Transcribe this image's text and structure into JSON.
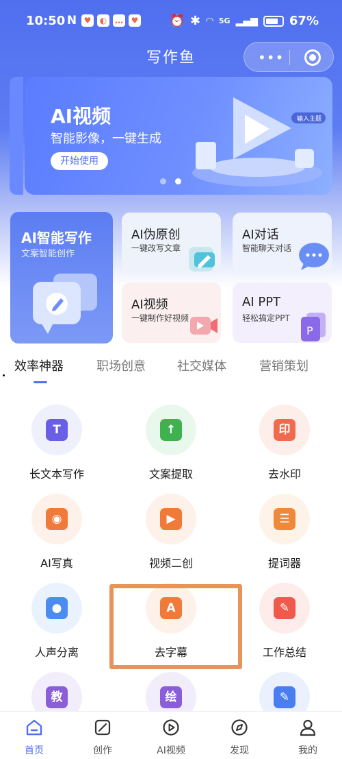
{
  "status_bar": {
    "time": "10:50",
    "battery": "67%",
    "network": "5G"
  },
  "nav": {
    "title": "写作鱼",
    "more_icon": "more-dots-icon",
    "close_icon": "target-icon"
  },
  "banner": {
    "title": "AI视频",
    "subtitle": "智能影像，一键生成",
    "button": "开始使用",
    "illustration_tag": "输入主题",
    "carousel_index": 2,
    "carousel_count": 2
  },
  "features": {
    "main": {
      "title": "AI智能写作",
      "subtitle": "文案智能创作"
    },
    "items": [
      {
        "title": "AI伪原创",
        "subtitle": "一键改写文章"
      },
      {
        "title": "AI对话",
        "subtitle": "智能聊天对话"
      },
      {
        "title": "AI视频",
        "subtitle": "一键制作好视频"
      },
      {
        "title": "AI PPT",
        "subtitle": "轻松搞定PPT"
      }
    ]
  },
  "tabs": [
    {
      "label": "效率神器",
      "active": true
    },
    {
      "label": "职场创意",
      "active": false
    },
    {
      "label": "社交媒体",
      "active": false
    },
    {
      "label": "营销策划",
      "active": false
    }
  ],
  "tools": [
    {
      "label": "长文本写作",
      "icon": "long-text-icon",
      "glyph": "T",
      "color": "#6a5ee6",
      "bg": "#eef0fb"
    },
    {
      "label": "文案提取",
      "icon": "folder-upload-icon",
      "glyph": "↑",
      "color": "#3fb14f",
      "bg": "#e9f8ec"
    },
    {
      "label": "去水印",
      "icon": "stamp-icon",
      "glyph": "印",
      "color": "#f06b4d",
      "bg": "#fdeeea"
    },
    {
      "label": "AI写真",
      "icon": "camera-icon",
      "glyph": "◉",
      "color": "#f07a3a",
      "bg": "#fdf1e9"
    },
    {
      "label": "视频二创",
      "icon": "play-icon",
      "glyph": "▶",
      "color": "#f07a3a",
      "bg": "#fdf1e9"
    },
    {
      "label": "提词器",
      "icon": "teleprompter-icon",
      "glyph": "☰",
      "color": "#f0883a",
      "bg": "#fdf3e9"
    },
    {
      "label": "人声分离",
      "icon": "voice-icon",
      "glyph": "●",
      "color": "#4a8cf0",
      "bg": "#eaf2fd"
    },
    {
      "label": "去字幕",
      "icon": "subtitle-remove-icon",
      "glyph": "A",
      "color": "#f07a3a",
      "bg": "#fdf1e9"
    },
    {
      "label": "工作总结",
      "icon": "edit-doc-icon",
      "glyph": "✎",
      "color": "#ef5a4d",
      "bg": "#fdecea"
    },
    {
      "label": "",
      "icon": "teach-icon",
      "glyph": "教",
      "color": "#8a5ed9",
      "bg": "#f2edfb"
    },
    {
      "label": "",
      "icon": "paint-icon",
      "glyph": "绘",
      "color": "#8a5ed9",
      "bg": "#f2edfb"
    },
    {
      "label": "",
      "icon": "doc-edit-icon",
      "glyph": "✎",
      "color": "#4a7ef0",
      "bg": "#eaf0fd"
    }
  ],
  "bottom_nav": [
    {
      "label": "首页",
      "icon": "home-icon",
      "active": true
    },
    {
      "label": "创作",
      "icon": "create-icon",
      "active": false
    },
    {
      "label": "AI视频",
      "icon": "video-icon",
      "active": false
    },
    {
      "label": "发现",
      "icon": "compass-icon",
      "active": false
    },
    {
      "label": "我的",
      "icon": "profile-icon",
      "active": false
    }
  ],
  "colors": {
    "primary": "#4f6ff0",
    "highlight": "#e9935a"
  }
}
